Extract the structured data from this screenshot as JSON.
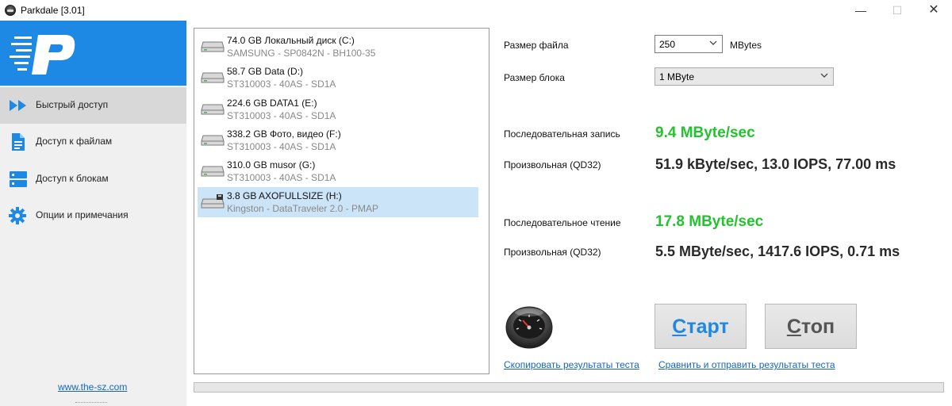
{
  "window": {
    "title": "Parkdale [3.01]",
    "min_glyph": "—",
    "max_glyph": "☐",
    "close_glyph": "✕"
  },
  "sidebar": {
    "logo_icon": "parkdale-p-logo",
    "items": [
      {
        "label": "Быстрый доступ",
        "icon": "fast-forward-icon",
        "active": true
      },
      {
        "label": "Доступ к файлам",
        "icon": "document-icon",
        "active": false
      },
      {
        "label": "Доступ к блокам",
        "icon": "blocks-icon",
        "active": false
      },
      {
        "label": "Опции и примечания",
        "icon": "gear-icon",
        "active": false
      }
    ],
    "website": "www.the-sz.com"
  },
  "drives": [
    {
      "name": "74.0 GB Локальный диск (C:)",
      "model": "SAMSUNG - SP0842N - BH100-35",
      "icon": "hard-drive-icon",
      "selected": false
    },
    {
      "name": "58.7 GB Data (D:)",
      "model": "ST310003 - 40AS - SD1A",
      "icon": "hard-drive-icon",
      "selected": false
    },
    {
      "name": "224.6 GB DATA1 (E:)",
      "model": "ST310003 - 40AS - SD1A",
      "icon": "hard-drive-icon",
      "selected": false
    },
    {
      "name": "338.2 GB Фото, видео (F:)",
      "model": "ST310003 - 40AS - SD1A",
      "icon": "hard-drive-icon",
      "selected": false
    },
    {
      "name": "310.0 GB musor (G:)",
      "model": "ST310003 - 40AS - SD1A",
      "icon": "hard-drive-icon",
      "selected": false
    },
    {
      "name": "3.8 GB AXOFULLSIZE (H:)",
      "model": "Kingston - DataTraveler 2.0 - PMAP",
      "icon": "removable-drive-icon",
      "selected": true
    }
  ],
  "settings": {
    "file_size_label": "Размер файла",
    "file_size_value": "250",
    "file_size_unit": "MBytes",
    "block_size_label": "Размер блока",
    "block_size_value": "1 MByte"
  },
  "results": {
    "seq_write_label": "Последовательная запись",
    "seq_write_value": "9.4 MByte/sec",
    "rand_write_label": "Произвольная (QD32)",
    "rand_write_value": "51.9 kByte/sec, 13.0 IOPS, 77.00 ms",
    "seq_read_label": "Последовательное чтение",
    "seq_read_value": "17.8 MByte/sec",
    "rand_read_label": "Произвольная (QD32)",
    "rand_read_value": "5.5 MByte/sec, 1417.6 IOPS, 0.71 ms"
  },
  "actions": {
    "start_underlined": "С",
    "start_rest": "тарт",
    "stop_underlined": "С",
    "stop_rest": "топ",
    "gauge_icon": "speedometer-icon",
    "copy_link": "Скопировать результаты теста",
    "compare_link": "Сравнить и отправить результаты теста"
  },
  "progress": {
    "value": 0
  },
  "colors": {
    "accent": "#1e88e5",
    "sequential_result": "#22c32e",
    "random_result": "#2a2a2a",
    "selected_row": "#cce4f7"
  }
}
